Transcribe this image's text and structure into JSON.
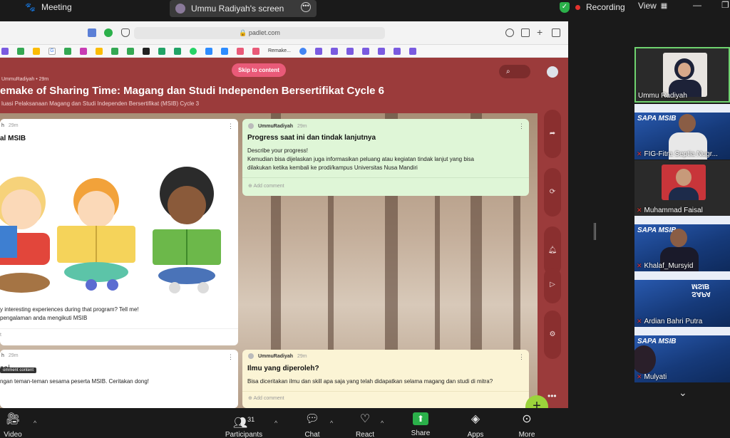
{
  "topbar": {
    "meeting_label": "Meeting",
    "screen_label": "Ummu Radiyah's screen",
    "recording_label": "Recording",
    "view_label": "View"
  },
  "browser": {
    "url": "padlet.com",
    "tab_label": "Remake..."
  },
  "padlet": {
    "skip_label": "Skip to content",
    "author": "UmmuRadiyah • 29m",
    "title": "emake of Sharing Time: Magang dan Studi Independen Bersertifikat Cycle 6",
    "subtitle": "luasi Pelaksanaan Magang dan Studi Independen Bersertifikat (MSIB) Cycle 3",
    "tooltip": "omment content",
    "cards": [
      {
        "author": "h",
        "time": "29m",
        "title": "al MSIB",
        "lines": [
          "y interesting experiences during that program? Tell me!",
          "pengalaman anda mengikuti MSIB"
        ],
        "add_comment": "t"
      },
      {
        "author": "UmmuRadiyah",
        "time": "29m",
        "title": "Progress saat ini dan tindak lanjutnya",
        "lines": [
          "Describe your progress!",
          "Kemudian bisa dijelaskan juga informasikan peluang atau kegiatan tindak lanjut yang bisa",
          "dilakukan ketika kembali ke prodi/kampus Universitas Nusa Mandiri"
        ],
        "add_comment": "Add comment"
      },
      {
        "author": "h",
        "time": "29m",
        "title": "asi",
        "lines": [
          "ngan teman-teman sesama peserta MSIB. Ceritakan dong!"
        ],
        "add_comment": ""
      },
      {
        "author": "UmmuRadiyah",
        "time": "29m",
        "title": "Ilmu yang diperoleh?",
        "lines": [
          "Bisa diceritakan ilmu dan skill apa saja yang telah didapatkan selama magang dan studi di mitra?"
        ],
        "add_comment": "Add comment"
      }
    ]
  },
  "participants": [
    {
      "name": "Ummu Radiyah",
      "muted": false
    },
    {
      "name": "FIG-Fitra Septia Nugr...",
      "muted": true
    },
    {
      "name": "Muhammad Faisal",
      "muted": true
    },
    {
      "name": "Khalaf_Mursyid",
      "muted": true
    },
    {
      "name": "Ardian Bahri Putra",
      "muted": true
    },
    {
      "name": "Mulyati",
      "muted": true
    }
  ],
  "banner_text": "SAPA MSIB",
  "toolbar": {
    "video": "Video",
    "participants": "Participants",
    "participants_count": "31",
    "chat": "Chat",
    "react": "React",
    "share": "Share",
    "apps": "Apps",
    "more": "More"
  },
  "colors": {
    "padlet_header": "#9b3b3b",
    "skip_button": "#e95a78",
    "fab": "#9bd43b",
    "share_green": "#2bb04a",
    "recording_red": "#e5322d"
  }
}
